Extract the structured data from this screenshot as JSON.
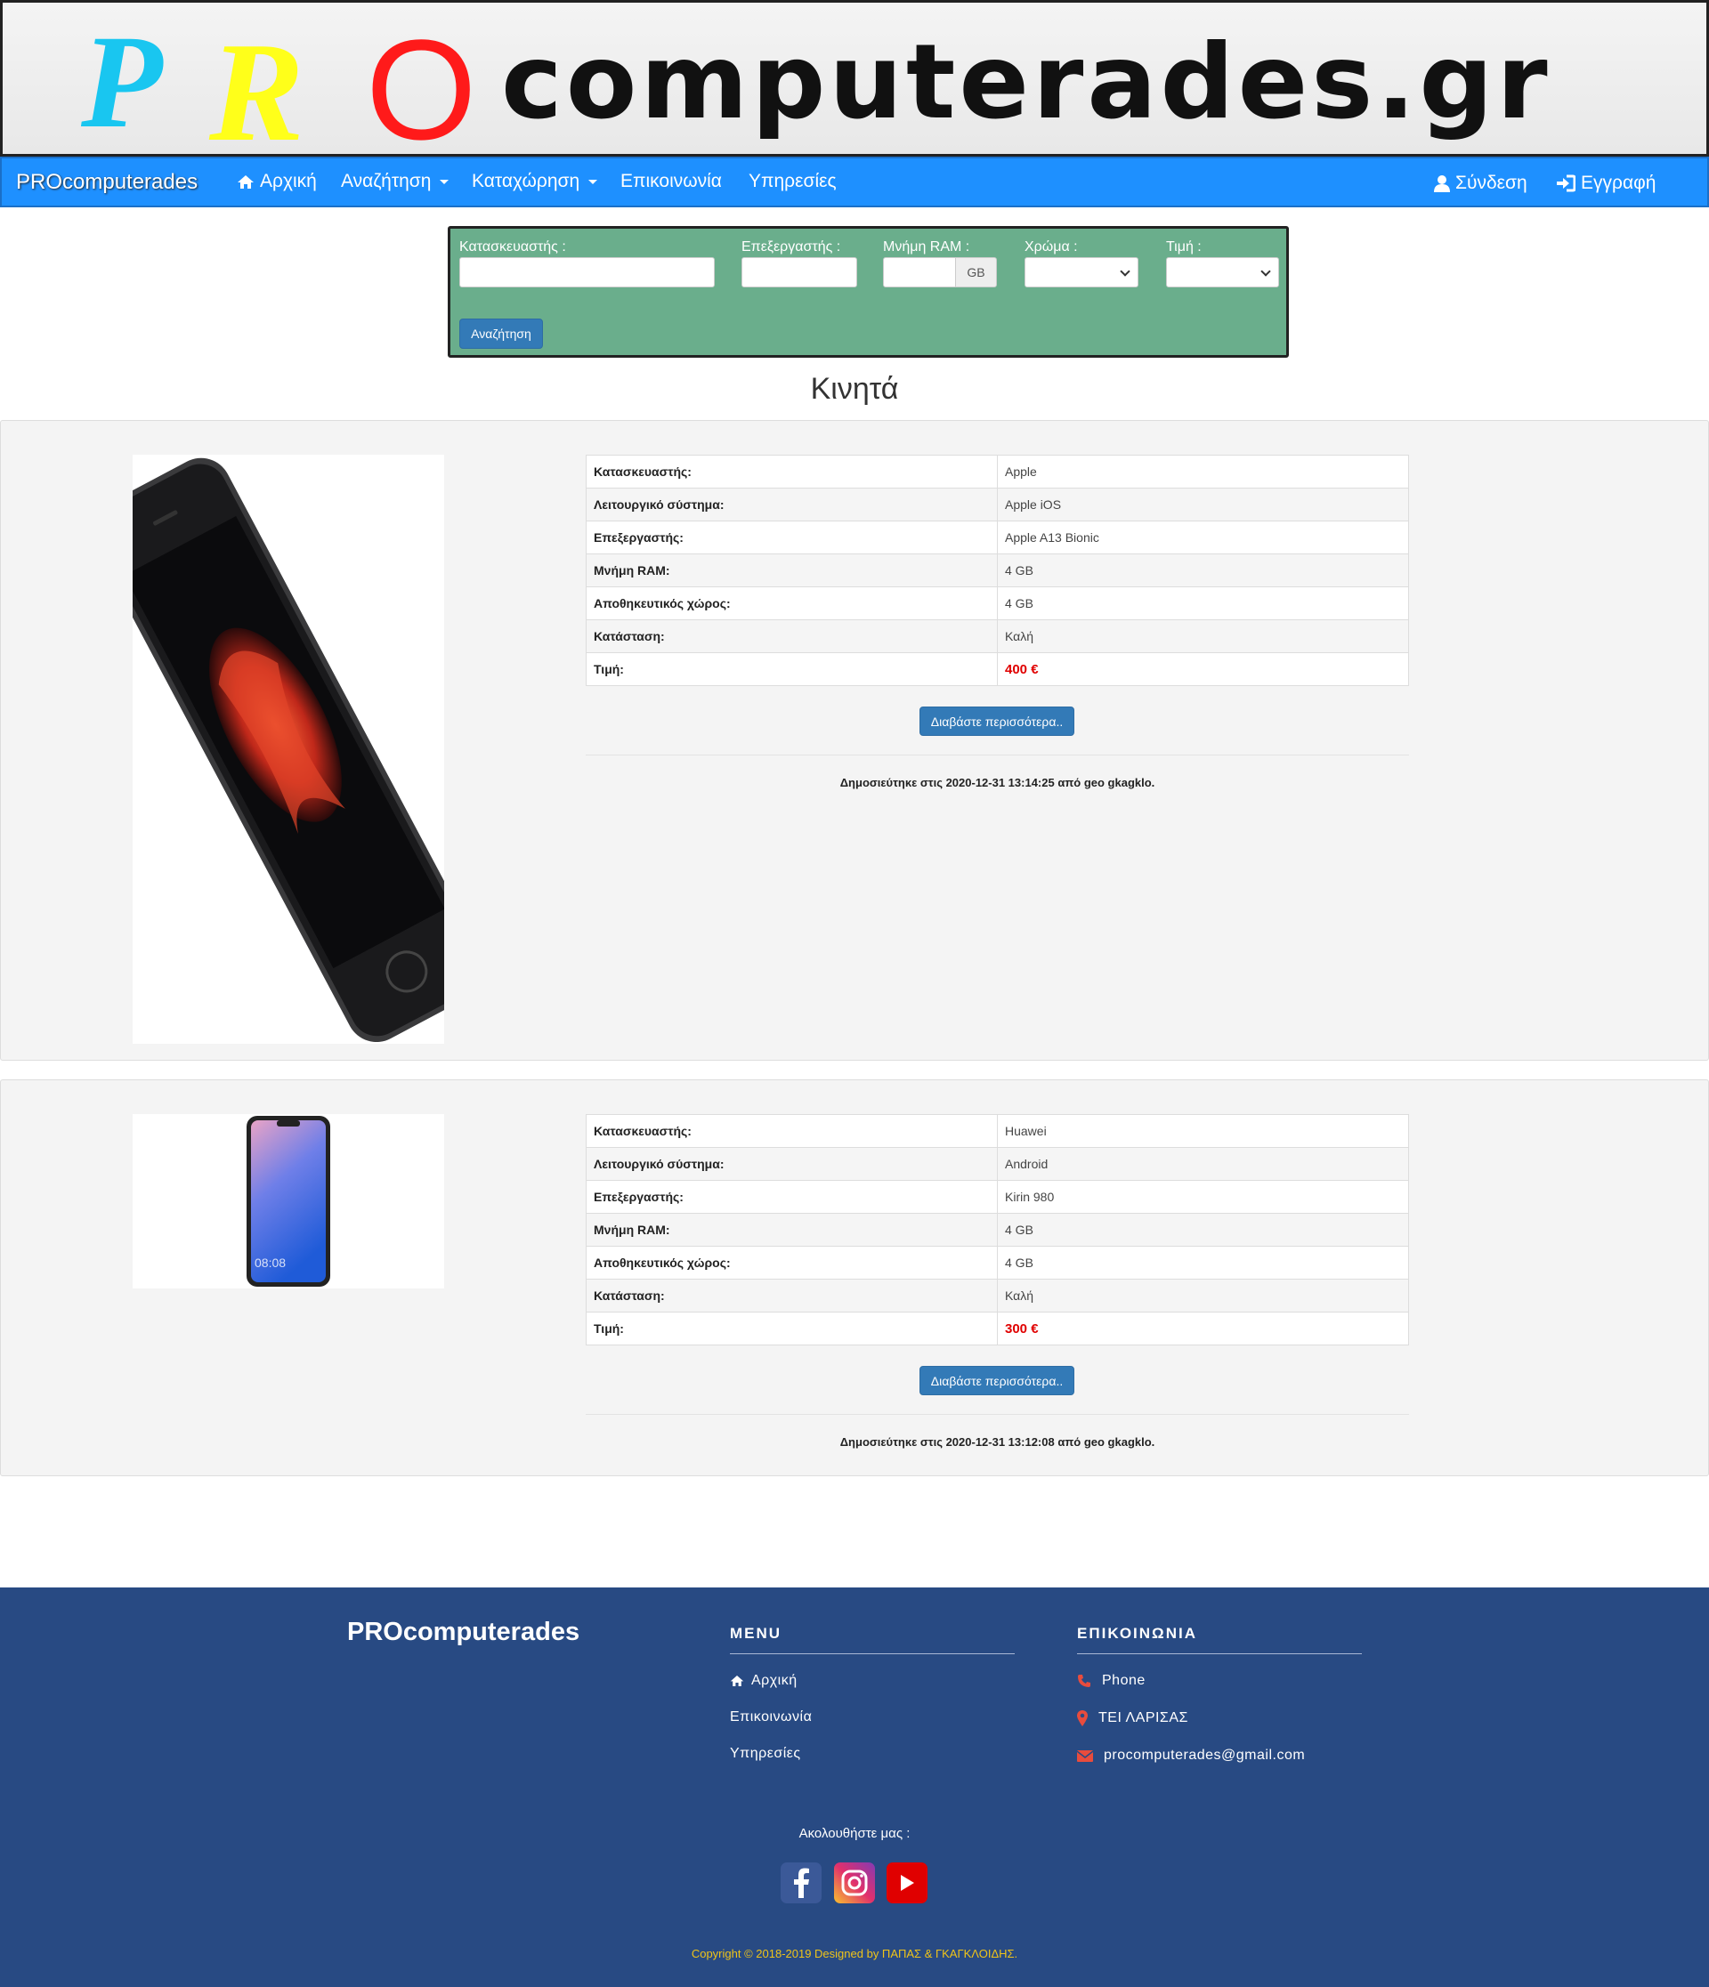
{
  "banner": {
    "logo_p": "P",
    "logo_r": "R",
    "logo_o": "O",
    "logo_rest": "computerades.gr"
  },
  "navbar": {
    "brand": "PROcomputerades",
    "home": "Αρχική",
    "search": "Αναζήτηση",
    "listing": "Καταχώρηση",
    "contact": "Επικοινωνία",
    "services": "Υπηρεσίες",
    "login": "Σύνδεση",
    "register": "Εγγραφή"
  },
  "search_form": {
    "manufacturer_label": "Κατασκευαστής :",
    "manufacturer_value": "",
    "processor_label": "Επεξεργαστής :",
    "processor_value": "",
    "ram_label": "Μνήμη RAM :",
    "ram_value": "",
    "ram_unit": "GB",
    "color_label": "Χρώμα :",
    "color_value": "",
    "price_label": "Τιμή :",
    "price_value": "",
    "submit": "Αναζήτηση"
  },
  "page_title": "Κινητά",
  "products": [
    {
      "specs": [
        {
          "key": "Κατασκευαστής:",
          "value": "Apple"
        },
        {
          "key": "Λειτουργικό σύστημα:",
          "value": "Apple iOS"
        },
        {
          "key": "Επεξεργαστής:",
          "value": "Apple A13 Bionic"
        },
        {
          "key": "Μνήμη RAM:",
          "value": "4 GB"
        },
        {
          "key": "Αποθηκευτικός χώρος:",
          "value": "4 GB"
        },
        {
          "key": "Κατάσταση:",
          "value": "Καλή"
        },
        {
          "key": "Τιμή:",
          "value": "400 €"
        }
      ],
      "more_button": "Διαβάστε περισσότερα..",
      "published": "Δημοσιεύτηκε στις 2020-12-31 13:14:25 από geo gkagklo."
    },
    {
      "screen_time": "08:08",
      "specs": [
        {
          "key": "Κατασκευαστής:",
          "value": "Huawei"
        },
        {
          "key": "Λειτουργικό σύστημα:",
          "value": "Android"
        },
        {
          "key": "Επεξεργαστής:",
          "value": "Kirin 980"
        },
        {
          "key": "Μνήμη RAM:",
          "value": "4 GB"
        },
        {
          "key": "Αποθηκευτικός χώρος:",
          "value": "4 GB"
        },
        {
          "key": "Κατάσταση:",
          "value": "Καλή"
        },
        {
          "key": "Τιμή:",
          "value": "300 €"
        }
      ],
      "more_button": "Διαβάστε περισσότερα..",
      "published": "Δημοσιεύτηκε στις 2020-12-31 13:12:08 από geo gkagklo."
    }
  ],
  "footer": {
    "brand": "PROcomputerades",
    "menu_heading": "MENU",
    "menu_items": [
      "Αρχική",
      "Επικοινωνία",
      "Υπηρεσίες"
    ],
    "contact_heading": "ΕΠΙΚΟΙΝΩΝΙΑ",
    "contact_items": [
      "Phone",
      "ΤΕΙ ΛΑΡΙΣΑΣ",
      "procomputerades@gmail.com"
    ],
    "follow": "Ακολουθήστε μας :",
    "copyright": "Copyright © 2018-2019 Designed by ΠΑΠΑΣ & ΓΚΑΓΚΛΟΙΔΗΣ.",
    "colors": {
      "background": "#284a83",
      "copyright": "#f0c419",
      "contact_icons": "#e84c3d"
    }
  },
  "colors": {
    "navbar": "#1e90ff",
    "search_panel": "#6aae8c",
    "button": "#337ab7",
    "price": "#e00000"
  }
}
